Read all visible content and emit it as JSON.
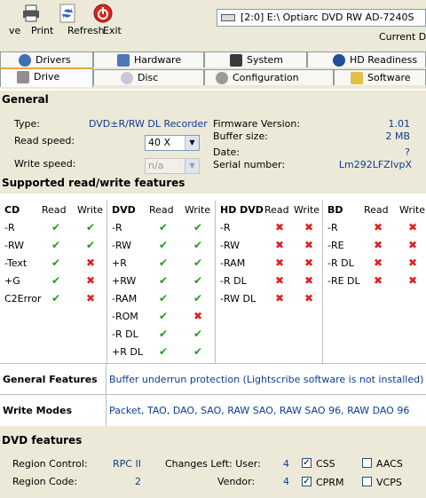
{
  "toolbar": {
    "items": [
      {
        "label": "ve",
        "icon": "save-icon"
      },
      {
        "label": "Print",
        "icon": "printer-icon"
      },
      {
        "label": "Refresh",
        "icon": "refresh-icon"
      },
      {
        "label": "Exit",
        "icon": "exit-icon"
      }
    ],
    "drive_select": "[2:0]  E:\\ Optiarc  DVD RW AD-7240S",
    "current_drive_label": "Current Dri"
  },
  "tabs": {
    "row1": [
      "Drivers",
      "Hardware",
      "System",
      "HD Readiness"
    ],
    "row2": [
      "Drive",
      "Disc",
      "Configuration",
      "Software"
    ],
    "active": "Drive"
  },
  "general": {
    "title": "General",
    "type_label": "Type:",
    "type_value": "DVD±R/RW DL Recorder",
    "read_speed_label": "Read speed:",
    "read_speed_value": "40 X",
    "write_speed_label": "Write speed:",
    "write_speed_value": "n/a",
    "firmware_label": "Firmware Version:",
    "firmware_value": "1.01",
    "buffer_label": "Buffer size:",
    "buffer_value": "2 MB",
    "date_label": "Date:",
    "date_value": "?",
    "serial_label": "Serial number:",
    "serial_value": "Lm292LFZIvpX"
  },
  "features": {
    "title": "Supported read/write features",
    "read_label": "Read",
    "write_label": "Write",
    "groups": [
      {
        "name": "CD",
        "rows": [
          [
            "-R",
            true,
            true
          ],
          [
            "-RW",
            true,
            true
          ],
          [
            "-Text",
            true,
            false
          ],
          [
            "+G",
            true,
            false
          ],
          [
            "C2Error",
            true,
            false
          ]
        ]
      },
      {
        "name": "DVD",
        "rows": [
          [
            "-R",
            true,
            true
          ],
          [
            "-RW",
            true,
            true
          ],
          [
            "+R",
            true,
            true
          ],
          [
            "+RW",
            true,
            true
          ],
          [
            "-RAM",
            true,
            true
          ],
          [
            "-ROM",
            true,
            false
          ],
          [
            "-R DL",
            true,
            true
          ],
          [
            "+R DL",
            true,
            true
          ]
        ]
      },
      {
        "name": "HD DVD",
        "rows": [
          [
            "-R",
            false,
            false
          ],
          [
            "-RW",
            false,
            false
          ],
          [
            "-RAM",
            false,
            false
          ],
          [
            "-R DL",
            false,
            false
          ],
          [
            "-RW DL",
            false,
            false
          ]
        ]
      },
      {
        "name": "BD",
        "rows": [
          [
            "-R",
            false,
            false
          ],
          [
            "-RE",
            false,
            false
          ],
          [
            "-R DL",
            false,
            false
          ],
          [
            "-RE DL",
            false,
            false
          ]
        ]
      }
    ]
  },
  "general_features": {
    "label": "General Features",
    "value": "Buffer underrun protection (Lightscribe software is not installed)"
  },
  "write_modes": {
    "label": "Write Modes",
    "value": "Packet, TAO, DAO, SAO, RAW SAO, RAW SAO 96, RAW DAO 96"
  },
  "dvd_features": {
    "title": "DVD features",
    "region_control_label": "Region Control:",
    "region_control_value": "RPC II",
    "region_code_label": "Region Code:",
    "region_code_value": "2",
    "changes_user_label": "Changes Left: User:",
    "changes_user_value": "4",
    "vendor_label": "Vendor:",
    "vendor_value": "4",
    "checks": [
      {
        "label": "CSS",
        "checked": true
      },
      {
        "label": "AACS",
        "checked": false
      },
      {
        "label": "CPRM",
        "checked": true
      },
      {
        "label": "VCPS",
        "checked": false
      }
    ]
  },
  "colors": {
    "check": "#18a018",
    "cross": "#e02020",
    "value_blue": "#0b3d91",
    "tab_accent": "#e6a63d"
  }
}
